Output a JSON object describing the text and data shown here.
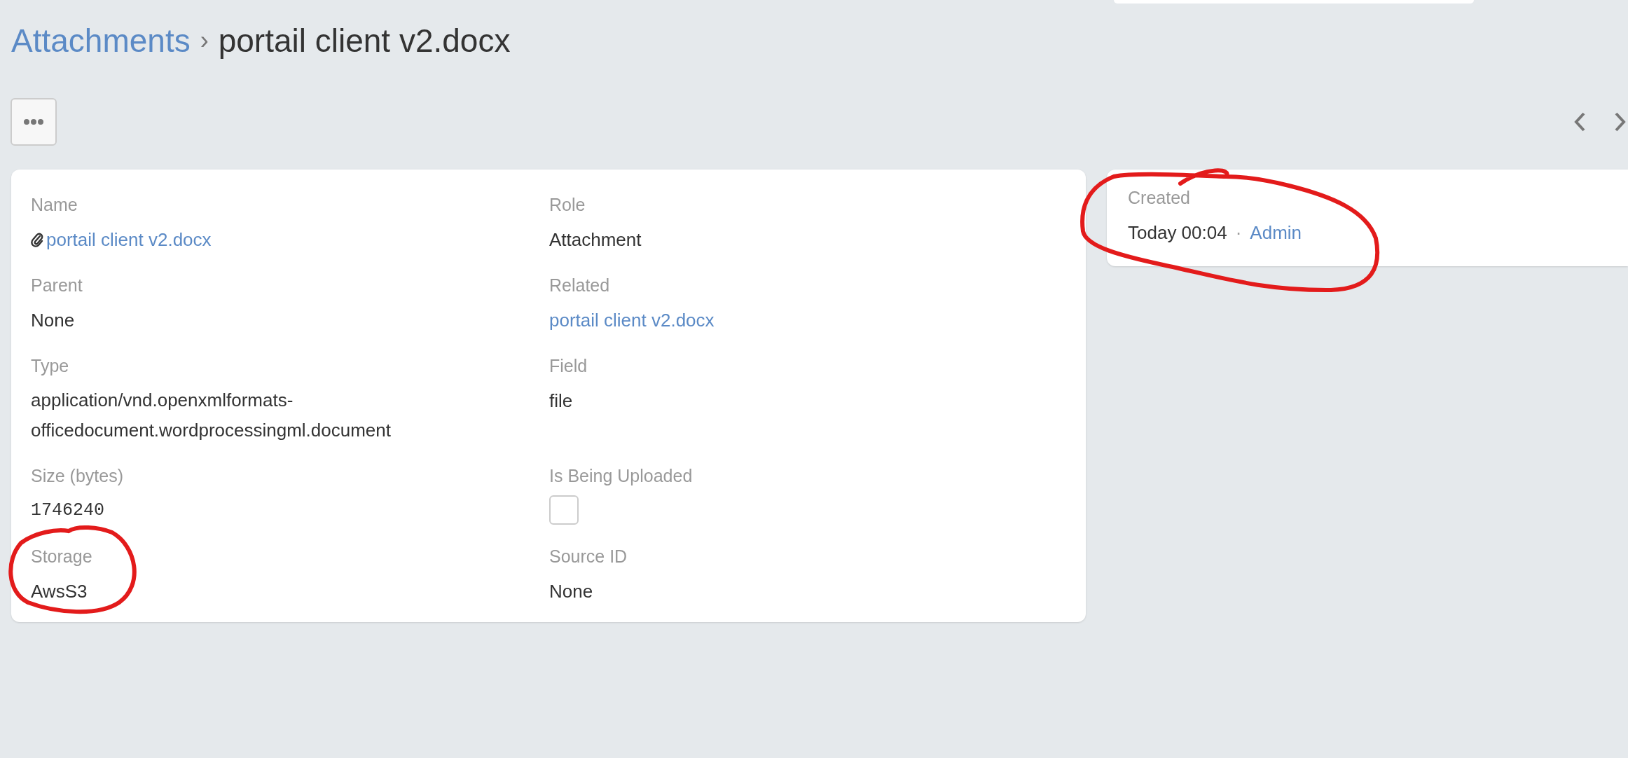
{
  "breadcrumb": {
    "parent": "Attachments",
    "separator": "›",
    "current": "portail client v2.docx"
  },
  "fields": [
    {
      "label": "Name",
      "kind": "file_link",
      "value": "portail client v2.docx"
    },
    {
      "label": "Role",
      "kind": "text",
      "value": "Attachment"
    },
    {
      "label": "Parent",
      "kind": "text",
      "value": "None"
    },
    {
      "label": "Related",
      "kind": "link",
      "value": "portail client v2.docx"
    },
    {
      "label": "Type",
      "kind": "lines",
      "lines": [
        "application/vnd.openxmlformats-",
        "officedocument.wordprocessingml.document"
      ]
    },
    {
      "label": "Field",
      "kind": "text",
      "value": "file"
    },
    {
      "label": "Size (bytes)",
      "kind": "number",
      "value": "1746240"
    },
    {
      "label": "Is Being Uploaded",
      "kind": "checkbox",
      "checked": false
    },
    {
      "label": "Storage",
      "kind": "text",
      "value": "AwsS3"
    },
    {
      "label": "Source ID",
      "kind": "text",
      "value": "None"
    }
  ],
  "side_panel": {
    "label": "Created",
    "value": "Today 00:04",
    "separator": "·",
    "user": "Admin"
  },
  "annotations": [
    {
      "kind": "circle"
    },
    {
      "kind": "circle"
    }
  ]
}
